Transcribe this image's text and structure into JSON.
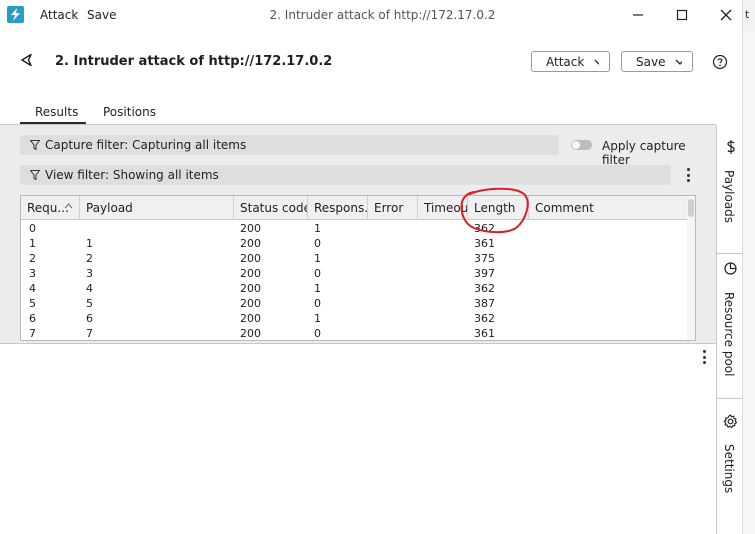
{
  "window": {
    "menu": [
      "Attack",
      "Save"
    ],
    "title": "2. Intruder attack of http://172.17.0.2",
    "edge_char": "t"
  },
  "header": {
    "title": "2. Intruder attack of http://172.17.0.2",
    "attack_button": "Attack",
    "save_button": "Save"
  },
  "tabs": [
    {
      "label": "Results",
      "active": true
    },
    {
      "label": "Positions",
      "active": false
    }
  ],
  "filters": {
    "capture_filter": "Capture filter: Capturing all items",
    "apply_capture_label": "Apply capture filter",
    "apply_capture_on": false,
    "view_filter": "View filter: Showing all items"
  },
  "table": {
    "columns": [
      "Requ...",
      "Payload",
      "Status code",
      "Respons...",
      "Error",
      "Timeout",
      "Length",
      "Comment"
    ],
    "sort_column": "Requ...",
    "rows": [
      [
        "0",
        "",
        "200",
        "1",
        "",
        "",
        "362",
        ""
      ],
      [
        "1",
        "1",
        "200",
        "0",
        "",
        "",
        "361",
        ""
      ],
      [
        "2",
        "2",
        "200",
        "1",
        "",
        "",
        "375",
        ""
      ],
      [
        "3",
        "3",
        "200",
        "0",
        "",
        "",
        "397",
        ""
      ],
      [
        "4",
        "4",
        "200",
        "1",
        "",
        "",
        "362",
        ""
      ],
      [
        "5",
        "5",
        "200",
        "0",
        "",
        "",
        "387",
        ""
      ],
      [
        "6",
        "6",
        "200",
        "1",
        "",
        "",
        "362",
        ""
      ],
      [
        "7",
        "7",
        "200",
        "0",
        "",
        "",
        "361",
        ""
      ]
    ]
  },
  "side_panel": {
    "items": [
      {
        "label": "Payloads",
        "icon": "dollar-icon"
      },
      {
        "label": "Resource pool",
        "icon": "pie-chart-icon"
      },
      {
        "label": "Settings",
        "icon": "gear-icon"
      }
    ]
  },
  "colors": {
    "app_icon": "#2a9bc6",
    "annotation": "#d81f26"
  }
}
